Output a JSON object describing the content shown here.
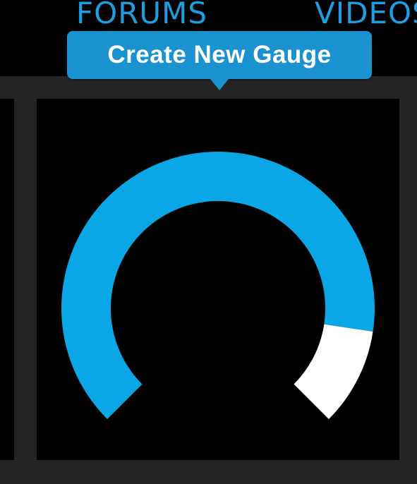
{
  "nav": {
    "items": [
      {
        "label": "FORUMS"
      },
      {
        "label": "VIDEOS"
      }
    ]
  },
  "tooltip": {
    "label": "Create New Gauge"
  },
  "gauge": {
    "value_fraction": 0.865,
    "sweep_degrees": 270,
    "colors": {
      "fill": "#0aa6e6",
      "remainder": "#ffffff",
      "background": "#000000",
      "frame": "#242424",
      "accent": "#1e9ee0"
    }
  }
}
